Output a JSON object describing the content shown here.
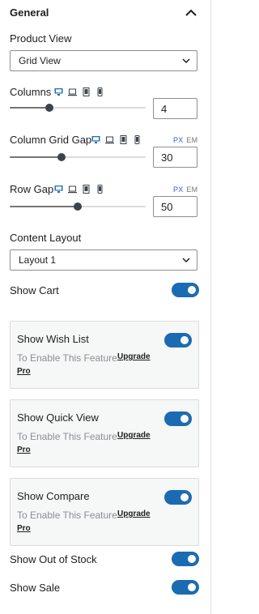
{
  "panel": {
    "title": "General"
  },
  "product_view": {
    "label": "Product View",
    "value": "Grid View"
  },
  "columns": {
    "label": "Columns",
    "value": "4",
    "slider_fraction": 0.29
  },
  "column_gap": {
    "label": "Column Grid Gap",
    "value": "30",
    "slider_fraction": 0.38,
    "unit_px": "PX",
    "unit_em": "EM"
  },
  "row_gap": {
    "label": "Row Gap",
    "value": "50",
    "slider_fraction": 0.5,
    "unit_px": "PX",
    "unit_em": "EM"
  },
  "content_layout": {
    "label": "Content Layout",
    "value": "Layout 1"
  },
  "show_cart": {
    "label": "Show Cart",
    "enabled": true
  },
  "pro_features": [
    {
      "label": "Show Wish List",
      "note": "To Enable This Feature",
      "upgrade": "Upgrade",
      "pro": "Pro",
      "enabled": true
    },
    {
      "label": "Show Quick View",
      "note": "To Enable This Feature",
      "upgrade": "Upgrade",
      "pro": "Pro",
      "enabled": true
    },
    {
      "label": "Show Compare",
      "note": "To Enable This Feature",
      "upgrade": "Upgrade",
      "pro": "Pro",
      "enabled": true
    }
  ],
  "show_out_of_stock": {
    "label": "Show Out of Stock",
    "enabled": true
  },
  "show_sale": {
    "label": "Show Sale",
    "enabled": true
  },
  "colors": {
    "accent": "#1b6bb3",
    "link": "#3858e9",
    "device_icon": "#2271b1"
  },
  "icons": [
    "chevron-up-icon",
    "chevron-down-icon",
    "desktop-icon",
    "laptop-icon",
    "tablet-icon",
    "mobile-icon"
  ]
}
